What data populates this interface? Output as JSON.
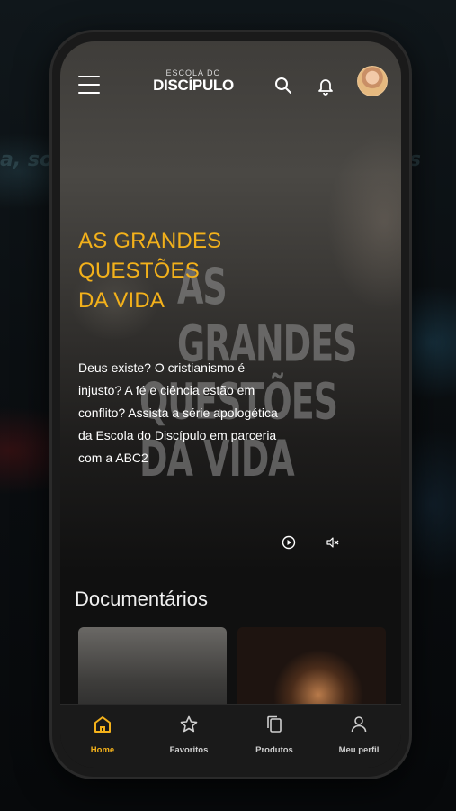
{
  "app": {
    "logo_top": "ESCOLA DO",
    "logo_main": "DISCÍPULO"
  },
  "header": {
    "menu_icon": "hamburger-menu-icon",
    "search_icon": "search-icon",
    "notifications_icon": "bell-icon",
    "avatar": "user-avatar"
  },
  "hero": {
    "title_lines": [
      "AS GRANDES",
      "QUESTÕES",
      "DA VIDA"
    ],
    "art_lines": [
      "AS GRANDES",
      "QUESTÕES DA VIDA"
    ],
    "description": "Deus existe? O cristianismo é injusto? A fé e ciência estão em conflito? Assista a série apologética da Escola do Discípulo em parceria com a ABC2",
    "play_icon": "play-circle-icon",
    "mute_icon": "volume-mute-icon",
    "accent_color": "#f3b11b"
  },
  "section": {
    "title": "Documentários",
    "cards": [
      {
        "name": "documentary-card-1"
      },
      {
        "name": "documentary-card-2"
      }
    ]
  },
  "bottom_nav": {
    "items": [
      {
        "label": "Home",
        "icon": "home-icon",
        "active": true
      },
      {
        "label": "Favoritos",
        "icon": "star-icon",
        "active": false
      },
      {
        "label": "Produtos",
        "icon": "copy-icon",
        "active": false
      },
      {
        "label": "Meu perfil",
        "icon": "user-icon",
        "active": false
      }
    ]
  }
}
